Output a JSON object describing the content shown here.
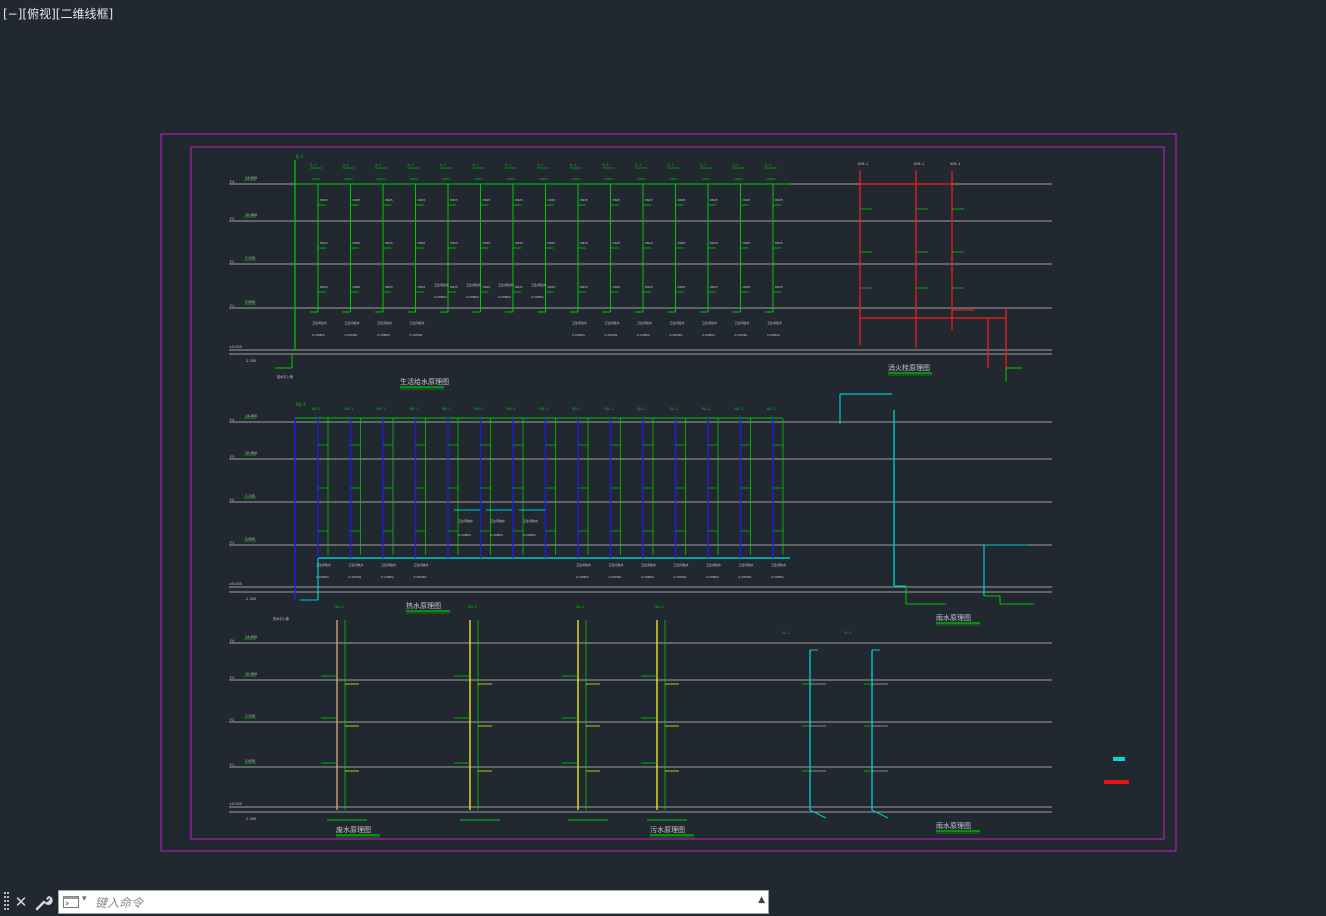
{
  "viewport": {
    "label": "[−][俯视][二维线框]"
  },
  "drawing": {
    "titles": {
      "supply": "生活给水原理图",
      "fire": "消火栓原理图",
      "hot": "热水原理图",
      "rain": "雨水原理图",
      "drain_left": "废水原理图",
      "drain_mid": "污水原理图",
      "drain_right": "雨水原理图"
    },
    "floor_marks": [
      "14.800",
      "10.600",
      "7.200",
      "3.600",
      "±0.000"
    ],
    "dims": {
      "low": "-1.300",
      "mid": "-1.300",
      "bottom": "-0.300"
    },
    "pipe_labels": {
      "jl": "JL-1",
      "rj": "RJL-1",
      "xl": "XHL-1",
      "wl": "WL-1",
      "fl": "FL-1",
      "yl": "YL-1",
      "dn": "DN50",
      "dn_small": "DN25",
      "pressure": "0.20MPa"
    },
    "colors": {
      "background": "#212830",
      "frame": "#c81ec8",
      "supply": "#00c800",
      "fire": "#dc1e1e",
      "hot": "#1e1edc",
      "rain": "#00c8c8",
      "waste": "#e6e61e",
      "waste_alt": "#d2a06e",
      "floor_line": "#c8c8c8"
    },
    "legend": [
      {
        "name": "cyan-legend",
        "color": "#00dcdc"
      },
      {
        "name": "red-legend",
        "color": "#e61414"
      }
    ]
  },
  "command": {
    "placeholder": "键入命令",
    "close": "✕",
    "history_arrow": "▲",
    "caret": "▾"
  }
}
